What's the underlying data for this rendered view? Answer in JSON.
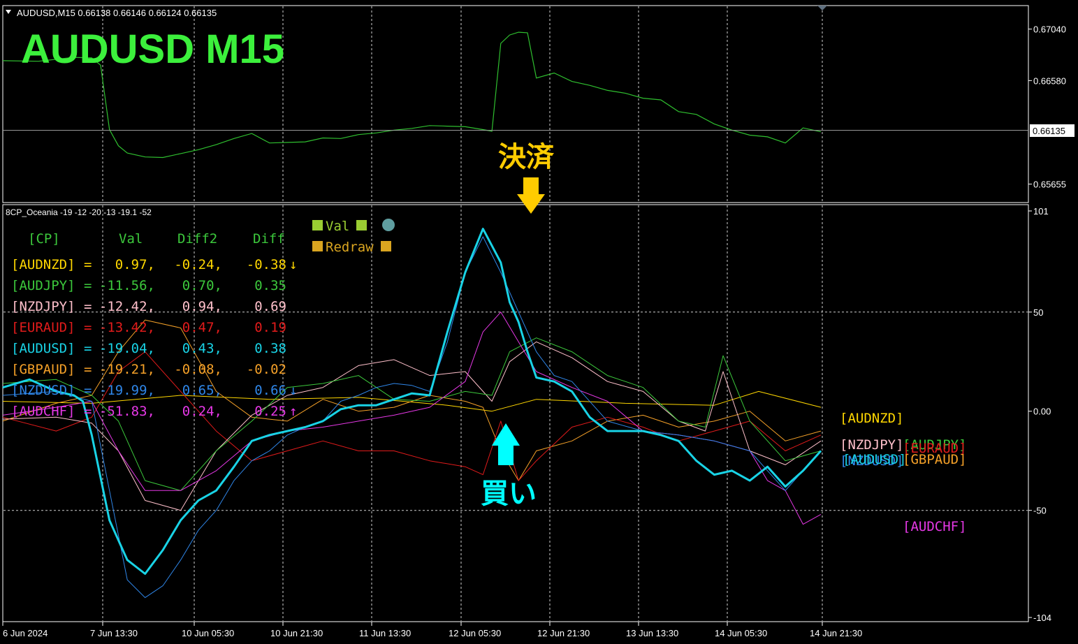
{
  "header": {
    "symbol_line": "AUDUSD,M15  0.66138 0.66146 0.66124 0.66135",
    "big_title": "AUDUSD  M15",
    "indicator_line": "8CP_Oceania -19 -12 -20 -13 -19.1 -52"
  },
  "colors": {
    "AUDNZD": "#ffd700",
    "AUDJPY": "#3cc83c",
    "NZDJPY": "#ffc0cb",
    "EURAUD": "#e11b1b",
    "AUDUSD": "#19d3e6",
    "GBPAUD": "#f4a028",
    "NZDUSD": "#2f86e8",
    "AUDCHF": "#e638e6",
    "price": "#2fbf2f",
    "title": "#3cf03c",
    "annotation_exit": "#ffcc00",
    "annotation_buy": "#00ffff"
  },
  "table": {
    "headers": [
      "[CP]",
      "Val",
      "Diff2",
      "Diff"
    ],
    "rows": [
      {
        "label": "[AUDNZD]",
        "val": "0.97,",
        "diff2": "-0.24,",
        "diff": "-0.38",
        "arrow": "↓",
        "key": "AUDNZD"
      },
      {
        "label": "[AUDJPY]",
        "val": "-11.56,",
        "diff2": "0.70,",
        "diff": "0.35",
        "arrow": "",
        "key": "AUDJPY"
      },
      {
        "label": "[NZDJPY]",
        "val": "-12.42,",
        "diff2": "0.94,",
        "diff": "0.69",
        "arrow": "",
        "key": "NZDJPY"
      },
      {
        "label": "[EURAUD]",
        "val": "-13.42,",
        "diff2": "0.47,",
        "diff": "0.19",
        "arrow": "",
        "key": "EURAUD"
      },
      {
        "label": "[AUDUSD]",
        "val": "-19.04,",
        "diff2": "0.43,",
        "diff": "0.38",
        "arrow": "",
        "key": "AUDUSD"
      },
      {
        "label": "[GBPAUD]",
        "val": "-19.21,",
        "diff2": "-0.08,",
        "diff": "-0.02",
        "arrow": "",
        "key": "GBPAUD"
      },
      {
        "label": "[NZDUSD]",
        "val": "-19.99,",
        "diff2": "0.65,",
        "diff": "0.66",
        "arrow": "↓",
        "key": "NZDUSD"
      },
      {
        "label": "[AUDCHF]",
        "val": "-51.83,",
        "diff2": "0.24,",
        "diff": "0.25",
        "arrow": "↑",
        "key": "AUDCHF"
      }
    ]
  },
  "legend_box": {
    "val": "Val",
    "redraw": "Redraw"
  },
  "annotations": {
    "exit": "決済",
    "buy": "買い"
  },
  "chart_data": [
    {
      "type": "line",
      "title": "AUDUSD,M15",
      "y_ticks": [
        "0.67040",
        "0.66580",
        "0.65655"
      ],
      "current_price_label": "0.66135",
      "ylim": [
        0.6549,
        0.6725
      ],
      "series": [
        {
          "name": "AUDUSD",
          "x": [
            0,
            4,
            8,
            10,
            11,
            12,
            13,
            14,
            16,
            18,
            20,
            22,
            24,
            26,
            28,
            30,
            32,
            34,
            36,
            38,
            40,
            42,
            44,
            46,
            48,
            50,
            52,
            54,
            55,
            56,
            57,
            58,
            59,
            60,
            62,
            64,
            66,
            68,
            70,
            72,
            74,
            76,
            78,
            80,
            82,
            84,
            86,
            88,
            90,
            92
          ],
          "values": [
            0.6675,
            0.6676,
            0.6678,
            0.6679,
            0.6671,
            0.6615,
            0.6599,
            0.6594,
            0.6589,
            0.659,
            0.6592,
            0.6597,
            0.66,
            0.6607,
            0.661,
            0.6603,
            0.6602,
            0.6604,
            0.6606,
            0.6607,
            0.6609,
            0.6612,
            0.6613,
            0.6616,
            0.6617,
            0.6618,
            0.6616,
            0.6615,
            0.6612,
            0.6692,
            0.6698,
            0.6702,
            0.67,
            0.6661,
            0.6664,
            0.6658,
            0.6653,
            0.665,
            0.6646,
            0.6643,
            0.664,
            0.6631,
            0.6627,
            0.662,
            0.6613,
            0.661,
            0.6607,
            0.6603,
            0.6615,
            0.6613
          ]
        }
      ]
    },
    {
      "type": "line",
      "title": "8CP_Oceania -19 -12 -20 -13 -19.1 -52",
      "x_ticks": [
        "6 Jun 2024",
        "7 Jun 13:30",
        "10 Jun 05:30",
        "10 Jun 21:30",
        "11 Jun 13:30",
        "12 Jun 05:30",
        "12 Jun 21:30",
        "13 Jun 13:30",
        "14 Jun 05:30",
        "14 Jun 21:30"
      ],
      "y_ticks": [
        "101",
        "50",
        "0.00",
        "-50",
        "-104"
      ],
      "ylim": [
        -104,
        101
      ],
      "series": [
        {
          "name": "AUDNZD",
          "x": [
            0,
            10,
            20,
            30,
            40,
            50,
            55,
            60,
            70,
            80,
            85,
            92
          ],
          "values": [
            5,
            4,
            8,
            6,
            7,
            3,
            0,
            6,
            4,
            3,
            10,
            2
          ]
        },
        {
          "name": "AUDJPY",
          "x": [
            0,
            6,
            10,
            13,
            16,
            20,
            24,
            28,
            32,
            36,
            40,
            44,
            48,
            52,
            55,
            57,
            60,
            64,
            68,
            72,
            76,
            79,
            81,
            84,
            88,
            92
          ],
          "values": [
            14,
            16,
            8,
            -5,
            -35,
            -40,
            -20,
            -5,
            12,
            14,
            18,
            6,
            5,
            10,
            8,
            30,
            37,
            30,
            18,
            12,
            -5,
            -8,
            28,
            -5,
            -25,
            -20
          ]
        },
        {
          "name": "NZDJPY",
          "x": [
            0,
            6,
            10,
            13,
            16,
            20,
            24,
            28,
            32,
            36,
            40,
            44,
            48,
            52,
            55,
            57,
            60,
            64,
            68,
            72,
            76,
            79,
            81,
            84,
            88,
            92
          ],
          "values": [
            -4,
            -3,
            -6,
            -20,
            -45,
            -50,
            -20,
            -2,
            8,
            12,
            23,
            26,
            18,
            20,
            5,
            25,
            35,
            27,
            15,
            10,
            -5,
            -10,
            20,
            -20,
            -27,
            -15
          ]
        },
        {
          "name": "EURAUD",
          "x": [
            0,
            6,
            10,
            13,
            16,
            20,
            24,
            28,
            32,
            36,
            40,
            44,
            48,
            52,
            54,
            56,
            58,
            60,
            64,
            68,
            72,
            76,
            80,
            84,
            88,
            92
          ],
          "values": [
            -3,
            -10,
            -3,
            20,
            30,
            10,
            -10,
            -25,
            -20,
            -15,
            -20,
            -20,
            -25,
            -28,
            -32,
            -5,
            -35,
            -25,
            -8,
            -3,
            -8,
            -15,
            -10,
            -5,
            -20,
            -12
          ]
        },
        {
          "name": "AUDUSD",
          "x": [
            0,
            3,
            6,
            8,
            9,
            10,
            12,
            14,
            16,
            18,
            20,
            22,
            24,
            26,
            28,
            30,
            32,
            34,
            36,
            38,
            40,
            42,
            44,
            46,
            48,
            50,
            52,
            54,
            56,
            57,
            58,
            59,
            60,
            62,
            64,
            66,
            68,
            70,
            72,
            74,
            76,
            78,
            80,
            82,
            84,
            86,
            88,
            90,
            92
          ],
          "values": [
            12,
            16,
            10,
            8,
            5,
            -12,
            -55,
            -75,
            -82,
            -70,
            -55,
            -45,
            -40,
            -28,
            -15,
            -12,
            -10,
            -8,
            -5,
            1,
            3,
            3,
            6,
            9,
            8,
            40,
            70,
            92,
            75,
            55,
            45,
            30,
            17,
            15,
            10,
            -3,
            -10,
            -10,
            -10,
            -12,
            -15,
            -25,
            -32,
            -30,
            -35,
            -28,
            -38,
            -30,
            -20
          ]
        },
        {
          "name": "GBPAUD",
          "x": [
            0,
            6,
            10,
            13,
            16,
            20,
            24,
            28,
            32,
            36,
            40,
            44,
            48,
            52,
            54,
            56,
            58,
            60,
            64,
            68,
            72,
            76,
            80,
            84,
            88,
            92
          ],
          "values": [
            -5,
            4,
            8,
            30,
            46,
            42,
            10,
            -3,
            -5,
            6,
            0,
            2,
            8,
            5,
            2,
            -20,
            -35,
            -20,
            -15,
            -5,
            -2,
            -8,
            -5,
            0,
            -15,
            -10
          ]
        },
        {
          "name": "NZDUSD",
          "x": [
            0,
            6,
            10,
            12,
            14,
            16,
            18,
            20,
            22,
            24,
            26,
            28,
            30,
            32,
            34,
            36,
            38,
            40,
            42,
            44,
            46,
            48,
            50,
            52,
            54,
            56,
            58,
            60,
            62,
            64,
            68,
            72,
            76,
            80,
            84,
            86,
            88,
            90,
            92
          ],
          "values": [
            8,
            10,
            5,
            -40,
            -85,
            -94,
            -88,
            -75,
            -60,
            -50,
            -35,
            -25,
            -20,
            -12,
            -8,
            -5,
            5,
            8,
            12,
            14,
            13,
            10,
            35,
            70,
            88,
            70,
            50,
            30,
            18,
            15,
            -5,
            -10,
            -12,
            -15,
            -20,
            -30,
            -40,
            -30,
            -20
          ]
        },
        {
          "name": "AUDCHF",
          "x": [
            0,
            6,
            10,
            13,
            16,
            20,
            24,
            28,
            32,
            36,
            40,
            44,
            48,
            52,
            54,
            56,
            58,
            60,
            64,
            68,
            72,
            76,
            80,
            84,
            86,
            88,
            90,
            92
          ],
          "values": [
            -2,
            2,
            5,
            -20,
            -40,
            -40,
            -30,
            -15,
            -10,
            -8,
            -5,
            -2,
            2,
            15,
            40,
            50,
            35,
            20,
            12,
            5,
            -10,
            -12,
            -15,
            -20,
            -35,
            -40,
            -57,
            -52
          ]
        }
      ]
    }
  ],
  "right_labels": [
    {
      "text": "[AUDNZD]",
      "key": "AUDNZD"
    },
    {
      "text": "[NZDJPY]",
      "key": "NZDJPY"
    },
    {
      "text": "[AUDJPY]",
      "key": "AUDJPY"
    },
    {
      "text": "[EURAUD]",
      "key": "EURAUD"
    },
    {
      "text": "[NZDUSD]",
      "key": "NZDUSD"
    },
    {
      "text": "[AUDUSD]",
      "key": "AUDUSD"
    },
    {
      "text": "[GBPAUD]",
      "key": "GBPAUD"
    },
    {
      "text": "[AUDCHF]",
      "key": "AUDCHF"
    }
  ]
}
